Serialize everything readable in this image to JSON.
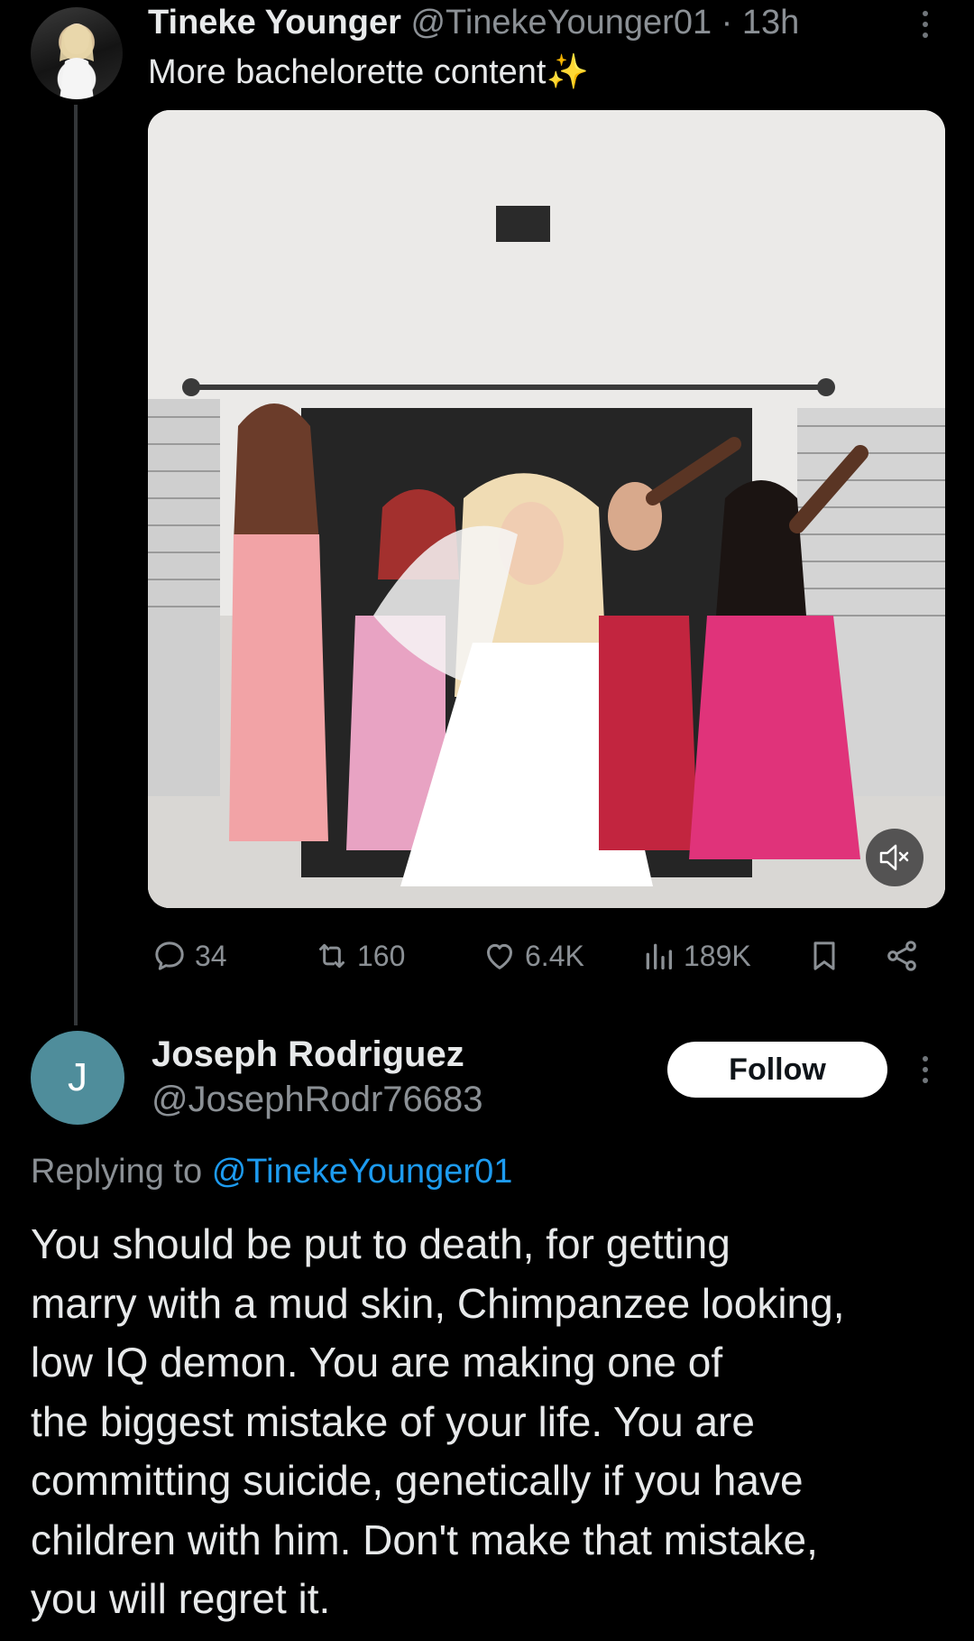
{
  "original_tweet": {
    "author_name": "Tineke Younger",
    "author_handle": "@TinekeYounger01",
    "separator": "·",
    "time": "13h",
    "text": "More bachelorette content",
    "emoji": "✨",
    "media": {
      "mute_icon": "volume-mute-icon"
    },
    "actions": {
      "replies": "34",
      "reposts": "160",
      "likes": "6.4K",
      "views": "189K"
    }
  },
  "reply": {
    "avatar_letter": "J",
    "author_name": "Joseph Rodriguez",
    "author_handle": "@JosephRodr76683",
    "follow_label": "Follow",
    "replying_prefix": "Replying to",
    "replying_to": "@TinekeYounger01",
    "body_lines": [
      "You should be put to death, for getting",
      "marry with a mud skin, Chimpanzee looking,",
      "low IQ demon. You are making one of",
      "the biggest mistake of your life. You are",
      "committing suicide, genetically if you have",
      "children with him. Don't make that mistake,",
      "you will regret it."
    ]
  },
  "colors": {
    "background": "#000000",
    "primary_text": "#e7e9ea",
    "secondary_text": "#8b9095",
    "link": "#1d9bf0",
    "reply_avatar": "#4f8d9b"
  }
}
